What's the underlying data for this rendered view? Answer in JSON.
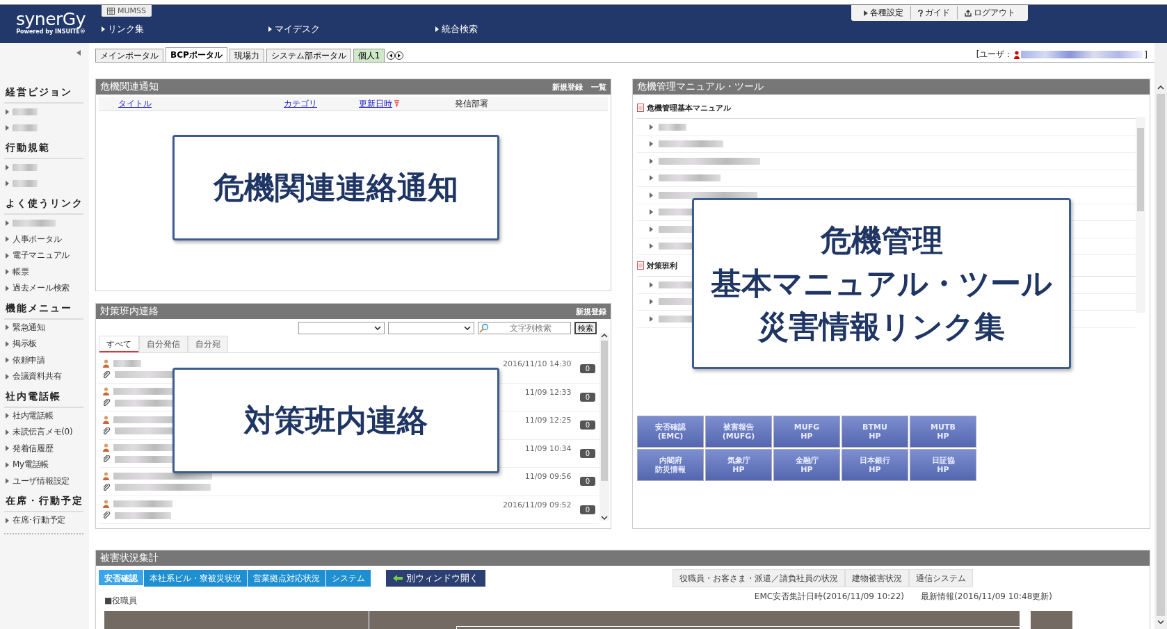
{
  "header": {
    "logo": "synerGy",
    "logo_sub": "Powered by INSUITE®",
    "app_tab": "MUMSS",
    "nav": [
      "リンク集",
      "マイデスク",
      "統合検索"
    ],
    "utility": [
      {
        "kind": "settings",
        "label": "各種設定"
      },
      {
        "kind": "guide",
        "label": "ガイド"
      },
      {
        "kind": "logout",
        "label": "ログアウト"
      }
    ]
  },
  "portal_tabs": [
    {
      "label": "メインポータル",
      "selected": false,
      "kind": "portal"
    },
    {
      "label": "BCPポータル",
      "selected": true,
      "kind": "portal"
    },
    {
      "label": "現場力",
      "selected": false,
      "kind": "portal"
    },
    {
      "label": "システム部ポータル",
      "selected": false,
      "kind": "portal"
    },
    {
      "label": "個人1",
      "selected": false,
      "kind": "personal"
    }
  ],
  "user": {
    "prefix": "[ユーザ：",
    "suffix": "]"
  },
  "sidebar": [
    {
      "title": "経営ビジョン",
      "items": [
        {
          "kind": "blurred"
        },
        {
          "kind": "blurred"
        }
      ]
    },
    {
      "title": "行動規範",
      "items": [
        {
          "kind": "blurred"
        },
        {
          "kind": "blurred"
        }
      ]
    },
    {
      "title": "よく使うリンク",
      "items": [
        {
          "kind": "blurred"
        },
        {
          "kind": "link",
          "label": "人事ポータル"
        },
        {
          "kind": "link",
          "label": "電子マニュアル"
        },
        {
          "kind": "link",
          "label": "帳票"
        },
        {
          "kind": "link",
          "label": "過去メール検索"
        }
      ]
    },
    {
      "title": "機能メニュー",
      "items": [
        {
          "kind": "link",
          "label": "緊急通知"
        },
        {
          "kind": "link",
          "label": "掲示板"
        },
        {
          "kind": "link",
          "label": "依頼申請"
        },
        {
          "kind": "link",
          "label": "会議資料共有"
        }
      ]
    },
    {
      "title": "社内電話帳",
      "items": [
        {
          "kind": "link",
          "label": "社内電話帳"
        },
        {
          "kind": "link",
          "label": "未読伝言メモ(0)"
        },
        {
          "kind": "link",
          "label": "発着信履歴"
        },
        {
          "kind": "link",
          "label": "My電話帳"
        },
        {
          "kind": "link",
          "label": "ユーザ情報設定"
        }
      ]
    },
    {
      "title": "在席・行動予定",
      "items": [
        {
          "kind": "link",
          "label": "在席･行動予定"
        }
      ]
    }
  ],
  "notice": {
    "title": "危機関連通知",
    "actions": [
      "新規登録",
      "一覧"
    ],
    "columns": [
      "タイトル",
      "カテゴリ",
      "更新日時",
      "発信部署"
    ],
    "overlay": "危機関連連絡通知"
  },
  "team": {
    "title": "対策班内連絡",
    "action": "新規登録",
    "search_placeholder": "文字列検索",
    "search_button": "検索",
    "tabs": [
      {
        "label": "すべて",
        "selected": true
      },
      {
        "label": "自分発信",
        "selected": false
      },
      {
        "label": "自分宛",
        "selected": false
      }
    ],
    "messages": [
      {
        "date": "2016/11/10 14:30",
        "count": "0"
      },
      {
        "date": "11/09 12:33",
        "count": "0"
      },
      {
        "date": "11/09 12:25",
        "count": "0"
      },
      {
        "date": "11/09 10:34",
        "count": "0"
      },
      {
        "date": "11/09 09:56",
        "count": "0"
      },
      {
        "date": "2016/11/09 09:52",
        "count": "0"
      }
    ],
    "overlay": "対策班内連絡"
  },
  "manual": {
    "title": "危機管理マニュアル・ツール",
    "groups": [
      {
        "title": "危機管理基本マニュアル",
        "items": [
          {
            "kind": "blurred"
          },
          {
            "kind": "blurred"
          },
          {
            "kind": "blurred"
          },
          {
            "kind": "blurred"
          },
          {
            "kind": "blurred"
          },
          {
            "kind": "blurred"
          },
          {
            "kind": "blurred"
          },
          {
            "kind": "blurred"
          }
        ]
      },
      {
        "title": "対策班利",
        "items": [
          {
            "kind": "blurred"
          },
          {
            "kind": "blurred"
          },
          {
            "kind": "blurred"
          }
        ]
      }
    ],
    "overlay": [
      "危機管理",
      "基本マニュアル・ツール",
      "災害情報リンク集"
    ],
    "link_buttons": [
      [
        "安否確認",
        "(EMC)"
      ],
      [
        "被害報告",
        "(MUFG)"
      ],
      [
        "MUFG",
        "HP"
      ],
      [
        "BTMU",
        "HP"
      ],
      [
        "MUTB",
        "HP"
      ],
      [
        "内閣府",
        "防災情報"
      ],
      [
        "気象庁",
        "HP"
      ],
      [
        "金融庁",
        "HP"
      ],
      [
        "日本銀行",
        "HP"
      ],
      [
        "日証協",
        "HP"
      ]
    ]
  },
  "damage": {
    "title": "被害状況集計",
    "tabs": [
      {
        "label": "安否確認",
        "selected": true
      },
      {
        "label": "本社系ビル・寮被災状況",
        "selected": false
      },
      {
        "label": "営業拠点対応状況",
        "selected": false
      },
      {
        "label": "システム",
        "selected": false
      }
    ],
    "open_window": "別ウィンドウ開く",
    "right_tabs": [
      "役職員・お客さま・派遣／請負社員の状況",
      "建物被害状況",
      "通信システム"
    ],
    "section": "■役職員",
    "emc_time": "EMC安否集計日時(2016/11/09 10:22)",
    "latest": "最新情報(2016/11/09 10:48更新)"
  }
}
